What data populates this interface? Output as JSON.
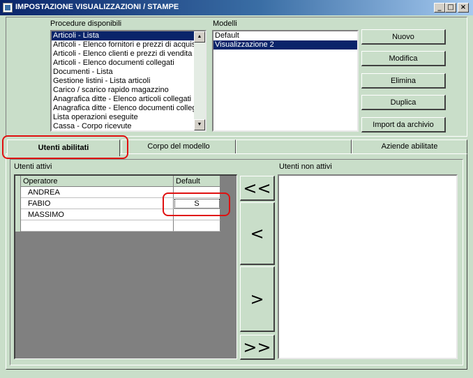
{
  "window": {
    "title": "IMPOSTAZIONE VISUALIZZAZIONI / STAMPE",
    "minimize": "_",
    "maximize": "□",
    "close": "×"
  },
  "procedures": {
    "label": "Procedure disponibili",
    "items": [
      "Articoli - Lista",
      "Articoli - Elenco fornitori e prezzi di acquisto",
      "Articoli - Elenco clienti e prezzi di vendita per",
      "Articoli - Elenco documenti collegati",
      "Documenti - Lista",
      "Gestione listini - Lista articoli",
      "Carico / scarico rapido magazzino",
      "Anagrafica ditte - Elenco articoli collegati",
      "Anagrafica ditte - Elenco documenti collegati",
      "Lista operazioni eseguite",
      "Cassa - Corpo ricevute"
    ],
    "selected_index": 0
  },
  "models": {
    "label": "Modelli",
    "items": [
      "Default",
      "Visualizzazione 2"
    ],
    "selected_index": 1
  },
  "buttons": {
    "new": "Nuovo",
    "edit": "Modifica",
    "delete": "Elimina",
    "duplicate": "Duplica",
    "import": "Import da archivio"
  },
  "tabs": [
    {
      "label": "Utenti abilitati",
      "active": true
    },
    {
      "label": "Corpo del modello",
      "active": false
    },
    {
      "label": "",
      "active": false
    },
    {
      "label": "Aziende abilitate",
      "active": false
    }
  ],
  "active_users": {
    "label": "Utenti attivi",
    "columns": [
      "Operatore",
      "Default"
    ],
    "rows": [
      {
        "operator": "ANDREA",
        "default": ""
      },
      {
        "operator": "FABIO",
        "default": "S"
      },
      {
        "operator": "MASSIMO",
        "default": ""
      },
      {
        "operator": "",
        "default": ""
      }
    ]
  },
  "inactive_users": {
    "label": "Utenti non attivi"
  },
  "transfer_buttons": {
    "all_left": "<<",
    "left": "<",
    "right": ">",
    "all_right": ">>"
  },
  "colors": {
    "background": "#c9dec9",
    "selection": "#0a246a",
    "highlight_annotation": "#e01010"
  }
}
